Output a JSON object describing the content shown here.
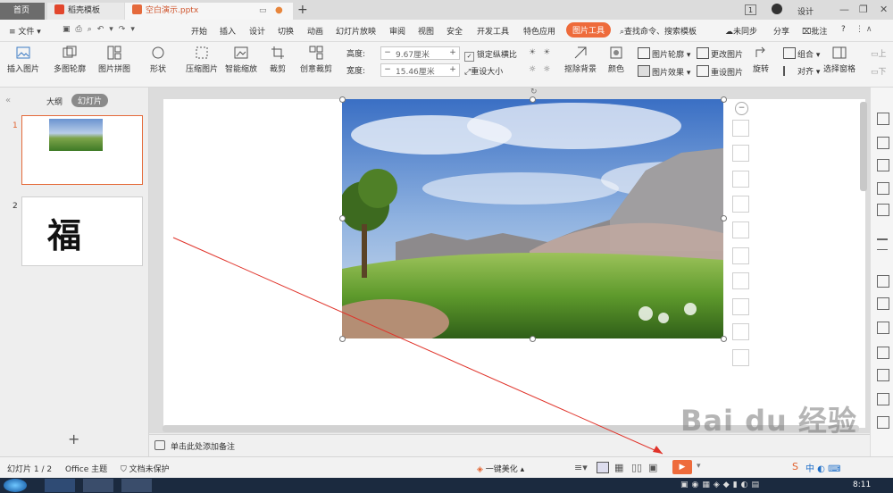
{
  "titlebar": {
    "tabs": [
      {
        "label": "首页"
      },
      {
        "label": "稻壳模板"
      },
      {
        "label": "空白演示.pptx"
      }
    ],
    "badge": "1",
    "right_label": "设计"
  },
  "menu": {
    "file": "文件",
    "items": [
      "开始",
      "插入",
      "设计",
      "切换",
      "动画",
      "幻灯片放映",
      "审阅",
      "视图",
      "安全",
      "开发工具",
      "特色应用",
      "图片工具"
    ],
    "search": "查找命令、搜索模板",
    "sync": "未同步",
    "share": "分享",
    "comment": "批注",
    "help": "?"
  },
  "ribbon": {
    "insert_pic": "插入图片",
    "multi_contour": "多图轮廓",
    "pic_collage": "图片拼图",
    "shape": "形状",
    "compress": "压缩图片",
    "smart_zoom": "智能缩放",
    "crop": "裁剪",
    "creative_crop": "创意裁剪",
    "height_label": "高度:",
    "height_value": "9.67厘米",
    "width_label": "宽度:",
    "width_value": "15.46厘米",
    "lock_ratio": "锁定纵横比",
    "reset_size": "重设大小",
    "remove_bg": "抠除背景",
    "color": "颜色",
    "pic_outline": "图片轮廓",
    "pic_effect": "图片效果",
    "change_pic": "更改图片",
    "reset_pic": "重设图片",
    "rotate": "旋转",
    "combine": "组合",
    "align": "对齐",
    "select_pane": "选择窗格",
    "up": "上",
    "down": "下"
  },
  "left_panel": {
    "tab_outline": "大纲",
    "tab_slides": "幻灯片",
    "slide1_num": "1",
    "slide2_num": "2",
    "slide2_text": "福"
  },
  "notes": {
    "placeholder": "单击此处添加备注"
  },
  "status": {
    "slide_counter": "幻灯片 1 / 2",
    "theme": "Office 主题",
    "protection": "文档未保护",
    "beautify": "一键美化"
  },
  "taskbar": {
    "time": "8:11"
  },
  "watermark": {
    "text": "Bai du 经验"
  },
  "colors": {
    "accent": "#ee6b3b",
    "arrow": "#e0332a"
  }
}
